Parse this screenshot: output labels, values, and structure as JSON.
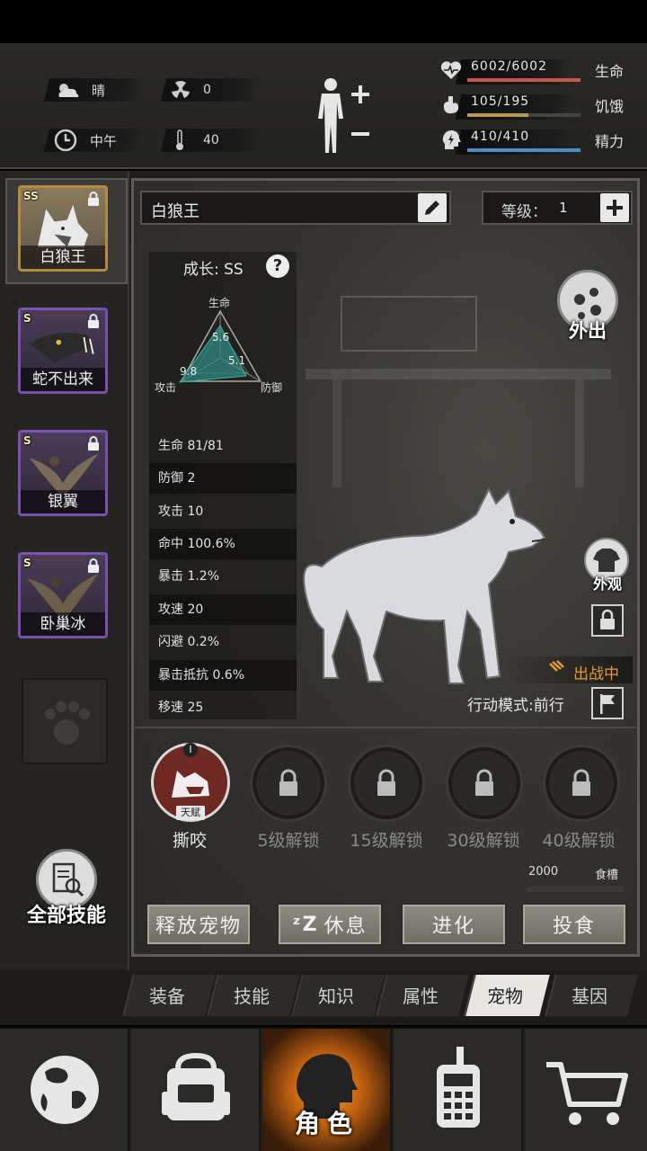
{
  "header": {
    "weather": "晴",
    "radiation": "0",
    "time": "中午",
    "temperature": "40",
    "bars": [
      {
        "value": "6002/6002",
        "label": "生命",
        "fraction": 1.0,
        "color": "#c9564a",
        "icon": "heart-pulse-icon"
      },
      {
        "value": "105/195",
        "label": "饥饿",
        "fraction": 0.54,
        "color": "#b59a4c",
        "icon": "stomach-icon"
      },
      {
        "value": "410/410",
        "label": "精力",
        "fraction": 1.0,
        "color": "#4a8fc9",
        "icon": "energy-head-icon"
      }
    ]
  },
  "pets": [
    {
      "name": "白狼王",
      "grade": "SS",
      "selected": true
    },
    {
      "name": "蛇不出来",
      "grade": "S",
      "selected": false
    },
    {
      "name": "银翼",
      "grade": "S",
      "selected": false
    },
    {
      "name": "卧巢冰",
      "grade": "S",
      "selected": false
    }
  ],
  "all_skills_label": "全部技能",
  "detail": {
    "pet_name": "白狼王",
    "level_label": "等级：",
    "level_value": "1",
    "growth": "成长: SS",
    "radar": {
      "top": "生命",
      "left": "攻击",
      "right": "防御",
      "v_top": "5.6",
      "v_right": "5.1",
      "v_left": "9.8"
    },
    "stats": [
      "生命 81/81",
      "防御 2",
      "攻击 10",
      "命中 100.6%",
      "暴击 1.2%",
      "攻速 20",
      "闪避 0.2%",
      "暴击抵抗 0.6%",
      "移速 25"
    ],
    "outing": "外出",
    "appearance": "外观",
    "battle_status": "出战中",
    "action_mode": "行动模式:前行"
  },
  "skills": {
    "first": {
      "name": "撕咬",
      "badge": "天赋",
      "level": "I"
    },
    "locked": [
      "5级解锁",
      "15级解锁",
      "30级解锁",
      "40级解锁"
    ]
  },
  "food": {
    "value": "2000",
    "label": "食槽"
  },
  "actions": [
    "释放宠物",
    "休息",
    "进化",
    "投食"
  ],
  "tabs": [
    "装备",
    "技能",
    "知识",
    "属性",
    "宠物",
    "基因"
  ],
  "active_tab": "宠物",
  "nav": {
    "active_label": "角色"
  }
}
